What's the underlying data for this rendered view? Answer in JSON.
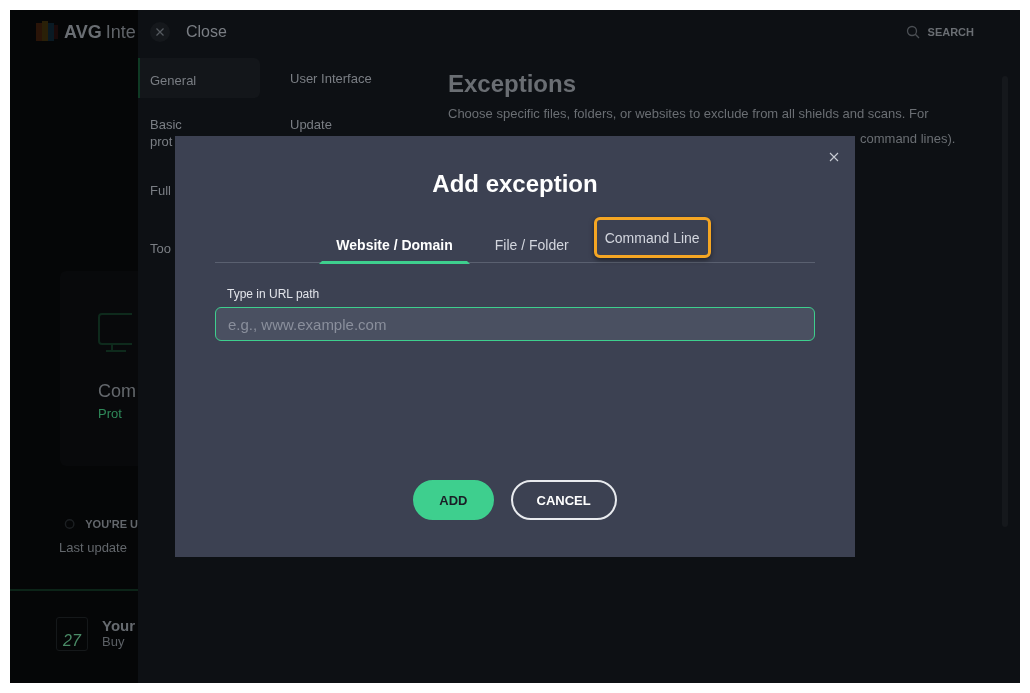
{
  "background_app": {
    "logo_text": "AVG",
    "title": "Inte",
    "card": {
      "title": "Com",
      "status": "Prot"
    },
    "update_status": "YOU'RE U",
    "last_updated": "Last update",
    "promo": {
      "day": "27",
      "title": "Your",
      "subtitle": "Buy"
    }
  },
  "settings": {
    "close_label": "Close",
    "search_label": "SEARCH",
    "nav_column_1": [
      {
        "label": "General",
        "selected": true
      },
      {
        "label": "Basic\nprot",
        "selected": false
      },
      {
        "label": "Full",
        "selected": false
      },
      {
        "label": "Too",
        "selected": false
      }
    ],
    "nav_column_2": [
      {
        "label": "User Interface",
        "selected": false
      },
      {
        "label": "Update",
        "selected": false
      }
    ],
    "heading": "Exceptions",
    "description_line_1": "Choose specific files, folders, or websites to exclude from all shields and scans. For",
    "description_line_2": "command lines)."
  },
  "dialog": {
    "title": "Add exception",
    "tabs": [
      {
        "label": "Website / Domain",
        "selected": true,
        "highlighted": false
      },
      {
        "label": "File / Folder",
        "selected": false,
        "highlighted": false
      },
      {
        "label": "Command Line",
        "selected": false,
        "highlighted": true
      }
    ],
    "field_label": "Type in URL path",
    "placeholder": "e.g., www.example.com",
    "buttons": [
      {
        "label": "ADD",
        "kind": "primary"
      },
      {
        "label": "CANCEL",
        "kind": "secondary"
      }
    ]
  }
}
